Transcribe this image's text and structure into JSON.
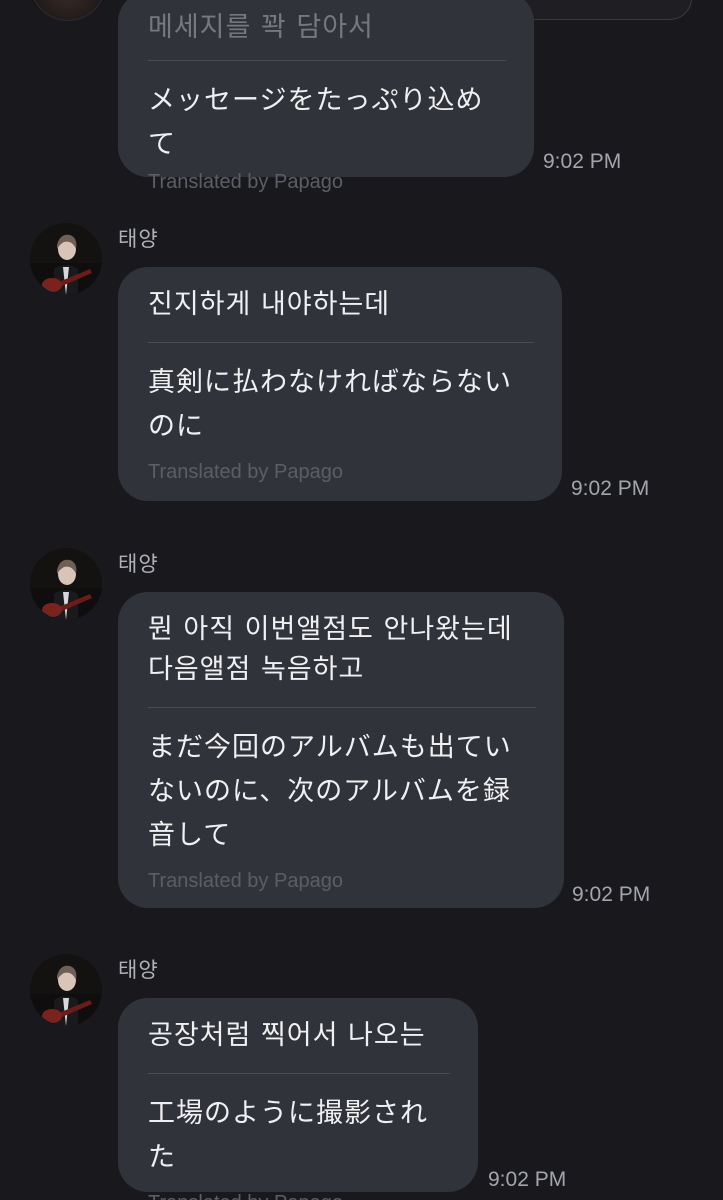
{
  "chat": {
    "messages": [
      {
        "sender": "",
        "original": "메세지를 꽉 담아서",
        "translated": "メッセージをたっぷり込めて",
        "credit": "Translated by Papago",
        "time": "9:02 PM"
      },
      {
        "sender": "태양",
        "original": "진지하게 내야하는데",
        "translated": "真剣に払わなければならないのに",
        "credit": "Translated by Papago",
        "time": "9:02 PM"
      },
      {
        "sender": "태양",
        "original": "뭔 아직 이번앨점도 안나왔는데 다음앨점 녹음하고",
        "translated": "まだ今回のアルバムも出ていないのに、次のアルバムを録音して",
        "credit": "Translated by Papago",
        "time": "9:02 PM"
      },
      {
        "sender": "태양",
        "original": "공장처럼 찍어서 나오는",
        "translated": "工場のように撮影された",
        "credit": "Translated by Papago",
        "time": "9:02 PM"
      }
    ]
  },
  "colors": {
    "background": "#19191d",
    "bubble": "#31333b",
    "credit_text": "#5c5e66",
    "timestamp": "#a3a5ad"
  },
  "icons": {
    "avatar": "profile-photo-guitarist"
  }
}
